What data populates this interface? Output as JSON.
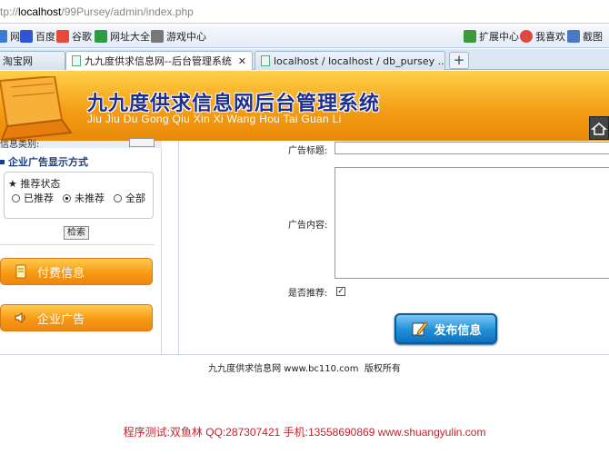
{
  "browser": {
    "address": {
      "prefix": "tp://",
      "host": "localhost",
      "path": "/99Pursey/admin/index.php"
    },
    "favorites": [
      {
        "icon": "pan-icon",
        "label": "网盘",
        "color": "#3a7bd5"
      },
      {
        "icon": "baidu-icon",
        "label": "百度",
        "color": "#2f55d4"
      },
      {
        "icon": "google-icon",
        "label": "谷歌",
        "color": "#e54b3c"
      },
      {
        "icon": "site-nav-icon",
        "label": "网址大全",
        "color": "#2e9b45"
      },
      {
        "icon": "game-icon",
        "label": "游戏中心",
        "color": "#777777"
      }
    ],
    "favorites_right": [
      {
        "icon": "extension-icon",
        "label": "扩展中心",
        "color": "#3c9a3c"
      },
      {
        "icon": "heart-icon",
        "label": "我喜欢",
        "color": "#e0483e"
      },
      {
        "icon": "screenshot-icon",
        "label": "截图",
        "color": "#4a78c2"
      }
    ],
    "tabs": [
      {
        "label": "淘宝网",
        "active": false
      },
      {
        "label": "九九度供求信息网--后台管理系统",
        "active": true
      },
      {
        "label": "localhost / localhost / db_pursey ...",
        "active": false
      }
    ],
    "new_tab_label": "+"
  },
  "banner": {
    "title": "九九度供求信息网后台管理系统",
    "pinyin": "Jiu Jiu Du Gong Qiu Xin Xi Wang Hou Tai Guan Li"
  },
  "sidebar": {
    "search_label": "信息类别:",
    "section_title": "企业广告显示方式",
    "recommend_legend": "★ 推荐状态",
    "options": [
      {
        "label": "已推荐",
        "checked": false
      },
      {
        "label": "未推荐",
        "checked": true
      },
      {
        "label": "全部",
        "checked": false
      }
    ],
    "search_button": "检索",
    "menu": [
      {
        "label": "付费信息",
        "icon": "paid-info-icon"
      },
      {
        "label": "企业广告",
        "icon": "speaker-icon"
      }
    ]
  },
  "form": {
    "title_label": "广告标题:",
    "title_value": "",
    "content_label": "广告内容:",
    "content_value": "",
    "recommend_label": "是否推荐:",
    "recommend_checked": true,
    "check_mark": "✓",
    "publish_button": "发布信息"
  },
  "footer": {
    "copyright": "九九度供求信息网 www.bc110.com  版权所有",
    "credit": "程序测试:双鱼林 QQ:287307421 手机:13558690869 www.shuangyulin.com"
  },
  "colors": {
    "banner_orange": "#f39b12",
    "title_blue": "#1f2f8f",
    "credit_red": "#c8202a",
    "publish_blue": "#1f8fd7"
  }
}
